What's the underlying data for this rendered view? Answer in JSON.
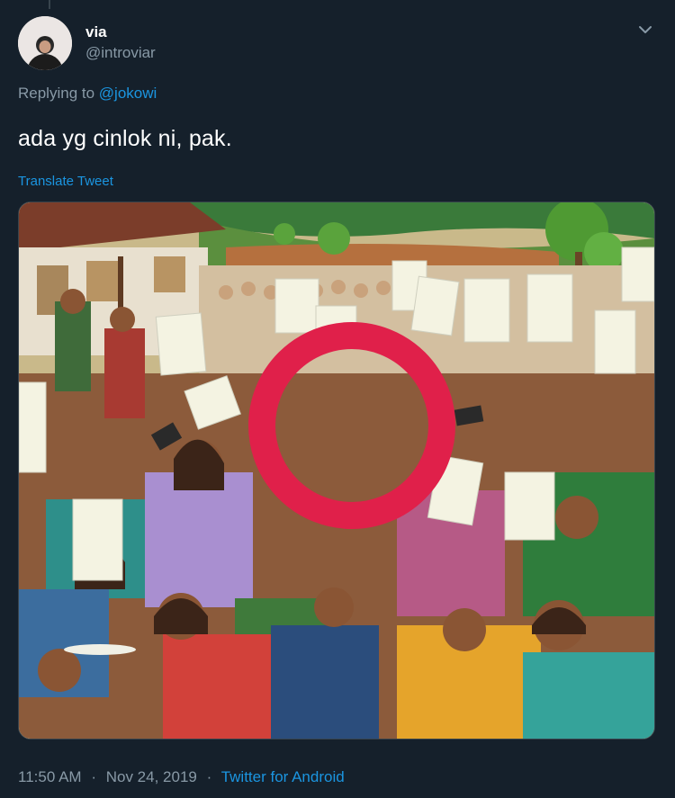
{
  "user": {
    "display_name": "via",
    "handle": "@introviar"
  },
  "reply": {
    "prefix": "Replying to",
    "mention": "@jokowi"
  },
  "tweet": {
    "text": "ada yg cinlok ni, pak.",
    "translate_label": "Translate Tweet"
  },
  "meta": {
    "time": "11:50 AM",
    "date": "Nov 24, 2019",
    "source": "Twitter for Android",
    "separator": "·"
  },
  "colors": {
    "background": "#15202b",
    "secondary_text": "#8899a6",
    "link": "#1b95e0",
    "highlight_circle": "#e0204a"
  },
  "icons": {
    "menu": "chevron-down-icon"
  }
}
